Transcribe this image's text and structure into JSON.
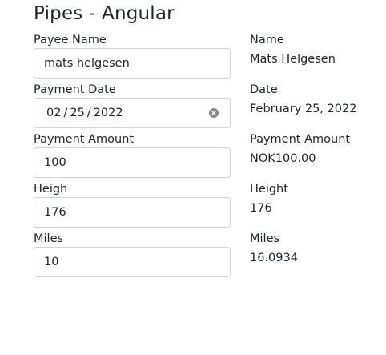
{
  "page": {
    "title": "Pipes - Angular"
  },
  "form": {
    "payee": {
      "label": "Payee Name",
      "value": "mats helgesen"
    },
    "date": {
      "label": "Payment Date",
      "month": "02",
      "day": "25",
      "year": "2022",
      "separator": "/"
    },
    "amount": {
      "label": "Payment Amount",
      "value": "100"
    },
    "height": {
      "label": "Heigh",
      "value": "176"
    },
    "miles": {
      "label": "Miles",
      "value": "10"
    }
  },
  "output": {
    "name": {
      "label": "Name",
      "value": "Mats Helgesen"
    },
    "date": {
      "label": "Date",
      "value": "February 25, 2022"
    },
    "amount": {
      "label": "Payment Amount",
      "value": "NOK100.00"
    },
    "height": {
      "label": "Height",
      "value": "176"
    },
    "miles": {
      "label": "Miles",
      "value": "16.0934"
    }
  },
  "icons": {
    "clear": "clear-circle-icon"
  }
}
